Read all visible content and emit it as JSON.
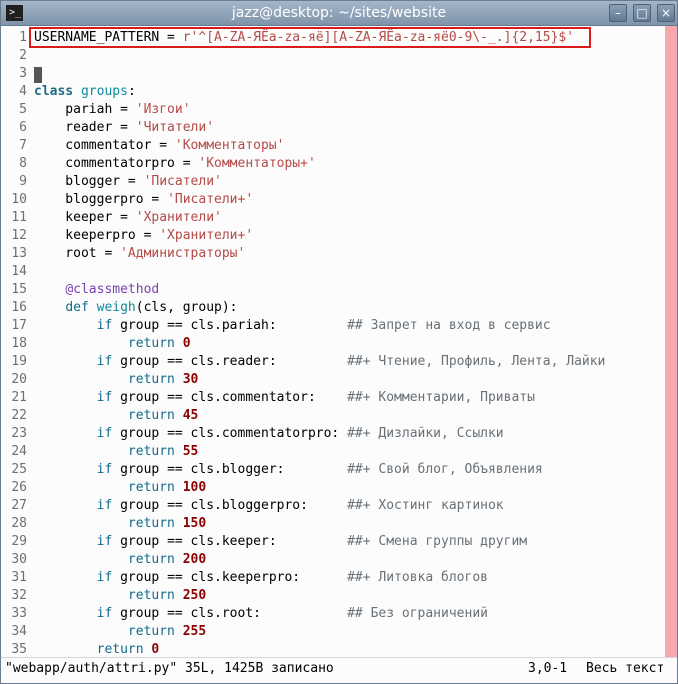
{
  "window": {
    "title": "jazz@desktop: ~/sites/website",
    "controls": {
      "minimize": "–",
      "maximize": "□",
      "close": "×"
    }
  },
  "editor": {
    "color_column": "#f7a8ad",
    "highlight_color": "#d81b1b",
    "lines": [
      {
        "n": "1",
        "tokens": [
          {
            "t": "USERNAME_PATTERN = ",
            "c": "text"
          },
          {
            "t": "r'^[A-ZA-ЯЁa-za-яё][A-ZA-ЯЁa-za-яё0-9\\-_.]{2,15}$'",
            "c": "string"
          }
        ]
      },
      {
        "n": "2",
        "tokens": []
      },
      {
        "n": "3",
        "tokens": [
          {
            "t": " ",
            "c": "cursor"
          }
        ]
      },
      {
        "n": "4",
        "tokens": [
          {
            "t": "class",
            "c": "class"
          },
          {
            "t": " ",
            "c": "text"
          },
          {
            "t": "groups",
            "c": "classname"
          },
          {
            "t": ":",
            "c": "text"
          }
        ]
      },
      {
        "n": "5",
        "tokens": [
          {
            "t": "    pariah = ",
            "c": "text"
          },
          {
            "t": "'Изгои'",
            "c": "string"
          }
        ]
      },
      {
        "n": "6",
        "tokens": [
          {
            "t": "    reader = ",
            "c": "text"
          },
          {
            "t": "'Читатели'",
            "c": "string"
          }
        ]
      },
      {
        "n": "7",
        "tokens": [
          {
            "t": "    commentator = ",
            "c": "text"
          },
          {
            "t": "'Комментаторы'",
            "c": "string"
          }
        ]
      },
      {
        "n": "8",
        "tokens": [
          {
            "t": "    commentatorpro = ",
            "c": "text"
          },
          {
            "t": "'Комментаторы+'",
            "c": "string"
          }
        ]
      },
      {
        "n": "9",
        "tokens": [
          {
            "t": "    blogger = ",
            "c": "text"
          },
          {
            "t": "'Писатели'",
            "c": "string"
          }
        ]
      },
      {
        "n": "10",
        "tokens": [
          {
            "t": "    bloggerpro = ",
            "c": "text"
          },
          {
            "t": "'Писатели+'",
            "c": "string"
          }
        ]
      },
      {
        "n": "11",
        "tokens": [
          {
            "t": "    keeper = ",
            "c": "text"
          },
          {
            "t": "'Хранители'",
            "c": "string"
          }
        ]
      },
      {
        "n": "12",
        "tokens": [
          {
            "t": "    keeperpro = ",
            "c": "text"
          },
          {
            "t": "'Хранители+'",
            "c": "string"
          }
        ]
      },
      {
        "n": "13",
        "tokens": [
          {
            "t": "    root = ",
            "c": "text"
          },
          {
            "t": "'Администраторы'",
            "c": "string"
          }
        ]
      },
      {
        "n": "14",
        "tokens": []
      },
      {
        "n": "15",
        "tokens": [
          {
            "t": "    ",
            "c": "text"
          },
          {
            "t": "@classmethod",
            "c": "decorator"
          }
        ]
      },
      {
        "n": "16",
        "tokens": [
          {
            "t": "    ",
            "c": "text"
          },
          {
            "t": "def",
            "c": "keyword"
          },
          {
            "t": " ",
            "c": "text"
          },
          {
            "t": "weigh",
            "c": "funcname"
          },
          {
            "t": "(cls, group):",
            "c": "text"
          }
        ]
      },
      {
        "n": "17",
        "tokens": [
          {
            "t": "        ",
            "c": "text"
          },
          {
            "t": "if",
            "c": "keyword"
          },
          {
            "t": " group == cls.pariah:         ",
            "c": "text"
          },
          {
            "t": "## Запрет на вход в сервис",
            "c": "comment"
          }
        ]
      },
      {
        "n": "18",
        "tokens": [
          {
            "t": "            ",
            "c": "text"
          },
          {
            "t": "return",
            "c": "keyword"
          },
          {
            "t": " ",
            "c": "text"
          },
          {
            "t": "0",
            "c": "number"
          }
        ]
      },
      {
        "n": "19",
        "tokens": [
          {
            "t": "        ",
            "c": "text"
          },
          {
            "t": "if",
            "c": "keyword"
          },
          {
            "t": " group == cls.reader:         ",
            "c": "text"
          },
          {
            "t": "##+ Чтение, Профиль, Лента, Лайки",
            "c": "comment"
          }
        ]
      },
      {
        "n": "20",
        "tokens": [
          {
            "t": "            ",
            "c": "text"
          },
          {
            "t": "return",
            "c": "keyword"
          },
          {
            "t": " ",
            "c": "text"
          },
          {
            "t": "30",
            "c": "number"
          }
        ]
      },
      {
        "n": "21",
        "tokens": [
          {
            "t": "        ",
            "c": "text"
          },
          {
            "t": "if",
            "c": "keyword"
          },
          {
            "t": " group == cls.commentator:    ",
            "c": "text"
          },
          {
            "t": "##+ Комментарии, Приваты",
            "c": "comment"
          }
        ]
      },
      {
        "n": "22",
        "tokens": [
          {
            "t": "            ",
            "c": "text"
          },
          {
            "t": "return",
            "c": "keyword"
          },
          {
            "t": " ",
            "c": "text"
          },
          {
            "t": "45",
            "c": "number"
          }
        ]
      },
      {
        "n": "23",
        "tokens": [
          {
            "t": "        ",
            "c": "text"
          },
          {
            "t": "if",
            "c": "keyword"
          },
          {
            "t": " group == cls.commentatorpro: ",
            "c": "text"
          },
          {
            "t": "##+ Дизлайки, Ссылки",
            "c": "comment"
          }
        ]
      },
      {
        "n": "24",
        "tokens": [
          {
            "t": "            ",
            "c": "text"
          },
          {
            "t": "return",
            "c": "keyword"
          },
          {
            "t": " ",
            "c": "text"
          },
          {
            "t": "55",
            "c": "number"
          }
        ]
      },
      {
        "n": "25",
        "tokens": [
          {
            "t": "        ",
            "c": "text"
          },
          {
            "t": "if",
            "c": "keyword"
          },
          {
            "t": " group == cls.blogger:        ",
            "c": "text"
          },
          {
            "t": "##+ Свой блог, Объявления",
            "c": "comment"
          }
        ]
      },
      {
        "n": "26",
        "tokens": [
          {
            "t": "            ",
            "c": "text"
          },
          {
            "t": "return",
            "c": "keyword"
          },
          {
            "t": " ",
            "c": "text"
          },
          {
            "t": "100",
            "c": "number"
          }
        ]
      },
      {
        "n": "27",
        "tokens": [
          {
            "t": "        ",
            "c": "text"
          },
          {
            "t": "if",
            "c": "keyword"
          },
          {
            "t": " group == cls.bloggerpro:     ",
            "c": "text"
          },
          {
            "t": "##+ Хостинг картинок",
            "c": "comment"
          }
        ]
      },
      {
        "n": "28",
        "tokens": [
          {
            "t": "            ",
            "c": "text"
          },
          {
            "t": "return",
            "c": "keyword"
          },
          {
            "t": " ",
            "c": "text"
          },
          {
            "t": "150",
            "c": "number"
          }
        ]
      },
      {
        "n": "29",
        "tokens": [
          {
            "t": "        ",
            "c": "text"
          },
          {
            "t": "if",
            "c": "keyword"
          },
          {
            "t": " group == cls.keeper:         ",
            "c": "text"
          },
          {
            "t": "##+ Смена группы другим",
            "c": "comment"
          }
        ]
      },
      {
        "n": "30",
        "tokens": [
          {
            "t": "            ",
            "c": "text"
          },
          {
            "t": "return",
            "c": "keyword"
          },
          {
            "t": " ",
            "c": "text"
          },
          {
            "t": "200",
            "c": "number"
          }
        ]
      },
      {
        "n": "31",
        "tokens": [
          {
            "t": "        ",
            "c": "text"
          },
          {
            "t": "if",
            "c": "keyword"
          },
          {
            "t": " group == cls.keeperpro:      ",
            "c": "text"
          },
          {
            "t": "##+ Литовка блогов",
            "c": "comment"
          }
        ]
      },
      {
        "n": "32",
        "tokens": [
          {
            "t": "            ",
            "c": "text"
          },
          {
            "t": "return",
            "c": "keyword"
          },
          {
            "t": " ",
            "c": "text"
          },
          {
            "t": "250",
            "c": "number"
          }
        ]
      },
      {
        "n": "33",
        "tokens": [
          {
            "t": "        ",
            "c": "text"
          },
          {
            "t": "if",
            "c": "keyword"
          },
          {
            "t": " group == cls.root:           ",
            "c": "text"
          },
          {
            "t": "## Без ограничений",
            "c": "comment"
          }
        ]
      },
      {
        "n": "34",
        "tokens": [
          {
            "t": "            ",
            "c": "text"
          },
          {
            "t": "return",
            "c": "keyword"
          },
          {
            "t": " ",
            "c": "text"
          },
          {
            "t": "255",
            "c": "number"
          }
        ]
      },
      {
        "n": "35",
        "tokens": [
          {
            "t": "        ",
            "c": "text"
          },
          {
            "t": "return",
            "c": "keyword"
          },
          {
            "t": " ",
            "c": "text"
          },
          {
            "t": "0",
            "c": "number"
          }
        ]
      }
    ]
  },
  "status": {
    "file_info": "\"webapp/auth/attri.py\" 35L, 1425B записано",
    "position": "3,0-1",
    "view": "Весь текст"
  }
}
